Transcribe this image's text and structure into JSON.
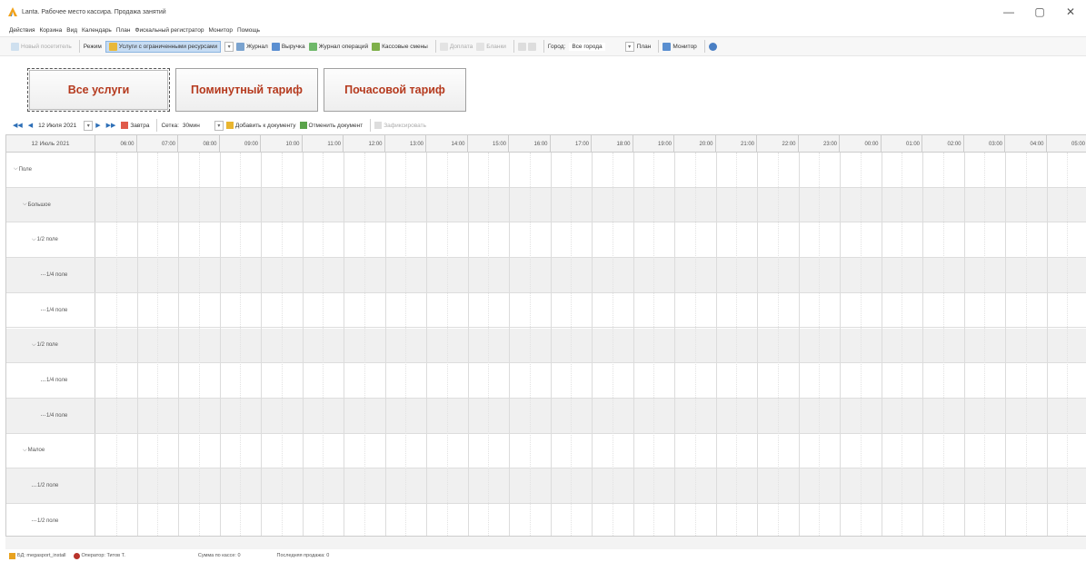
{
  "window": {
    "title": "Lanta. Рабочее место кассира. Продажа занятий",
    "controls": [
      "—",
      "▢",
      "✕"
    ]
  },
  "menu": [
    "Действия",
    "Корзина",
    "Вид",
    "Календарь",
    "План",
    "Фискальный регистратор",
    "Монитор",
    "Помощь"
  ],
  "toolbar": {
    "new_visitor": "Новый посетитель",
    "mode": "Режим",
    "services_limited": "Услуги с ограниченными ресурсами",
    "journal": "Журнал",
    "revenue": "Выручка",
    "ops_journal": "Журнал операций",
    "cash_shifts": "Кассовые смены",
    "surcharge": "Доплата",
    "blanks": "Бланки",
    "city_label": "Город:",
    "city_value": "Все города",
    "plan": "План",
    "monitor": "Монитор"
  },
  "big_buttons": [
    "Все услуги",
    "Поминутный тариф",
    "Почасовой тариф"
  ],
  "nav": {
    "date": "12 Июля 2021",
    "tomorrow": "Завтра",
    "cells_label": "Сетка:",
    "cells_value": "30мин",
    "add_to_doc": "Добавить к документу",
    "cancel_doc": "Отменить документ",
    "fix": "Зафиксировать"
  },
  "grid": {
    "date_header": "12 Июль 2021",
    "hours": [
      "06:00",
      "07:00",
      "08:00",
      "09:00",
      "10:00",
      "11:00",
      "12:00",
      "13:00",
      "14:00",
      "15:00",
      "16:00",
      "17:00",
      "18:00",
      "19:00",
      "20:00",
      "21:00",
      "22:00",
      "23:00",
      "00:00",
      "01:00",
      "02:00",
      "03:00",
      "04:00",
      "05:00"
    ],
    "rows": [
      {
        "label": "Поле",
        "level": 0,
        "expanded": true
      },
      {
        "label": "Большое",
        "level": 1,
        "expanded": true
      },
      {
        "label": "1/2 поле",
        "level": 2,
        "expanded": true
      },
      {
        "label": "1/4 поле",
        "level": 3,
        "expanded": false
      },
      {
        "label": "1/4 поле",
        "level": 3,
        "expanded": false
      },
      {
        "label": "1/2 поле",
        "level": 2,
        "expanded": true
      },
      {
        "label": "1/4 поле",
        "level": 3,
        "expanded": false
      },
      {
        "label": "1/4 поле",
        "level": 3,
        "expanded": false
      },
      {
        "label": "Малое",
        "level": 1,
        "expanded": true
      },
      {
        "label": "1/2 поле",
        "level": 2,
        "expanded": false
      },
      {
        "label": "1/2 поле",
        "level": 2,
        "expanded": false
      }
    ]
  },
  "status": {
    "db": "БД: megasport_install",
    "operator": "Оператор: Титов Т.",
    "cash_sum": "Сумма по кассе: 0",
    "last_sale": "Последняя продажа: 0"
  },
  "colors": {
    "accent_red": "#b53a1e",
    "selection_blue": "#c6dcf3",
    "nav_blue": "#2d6fb7"
  }
}
